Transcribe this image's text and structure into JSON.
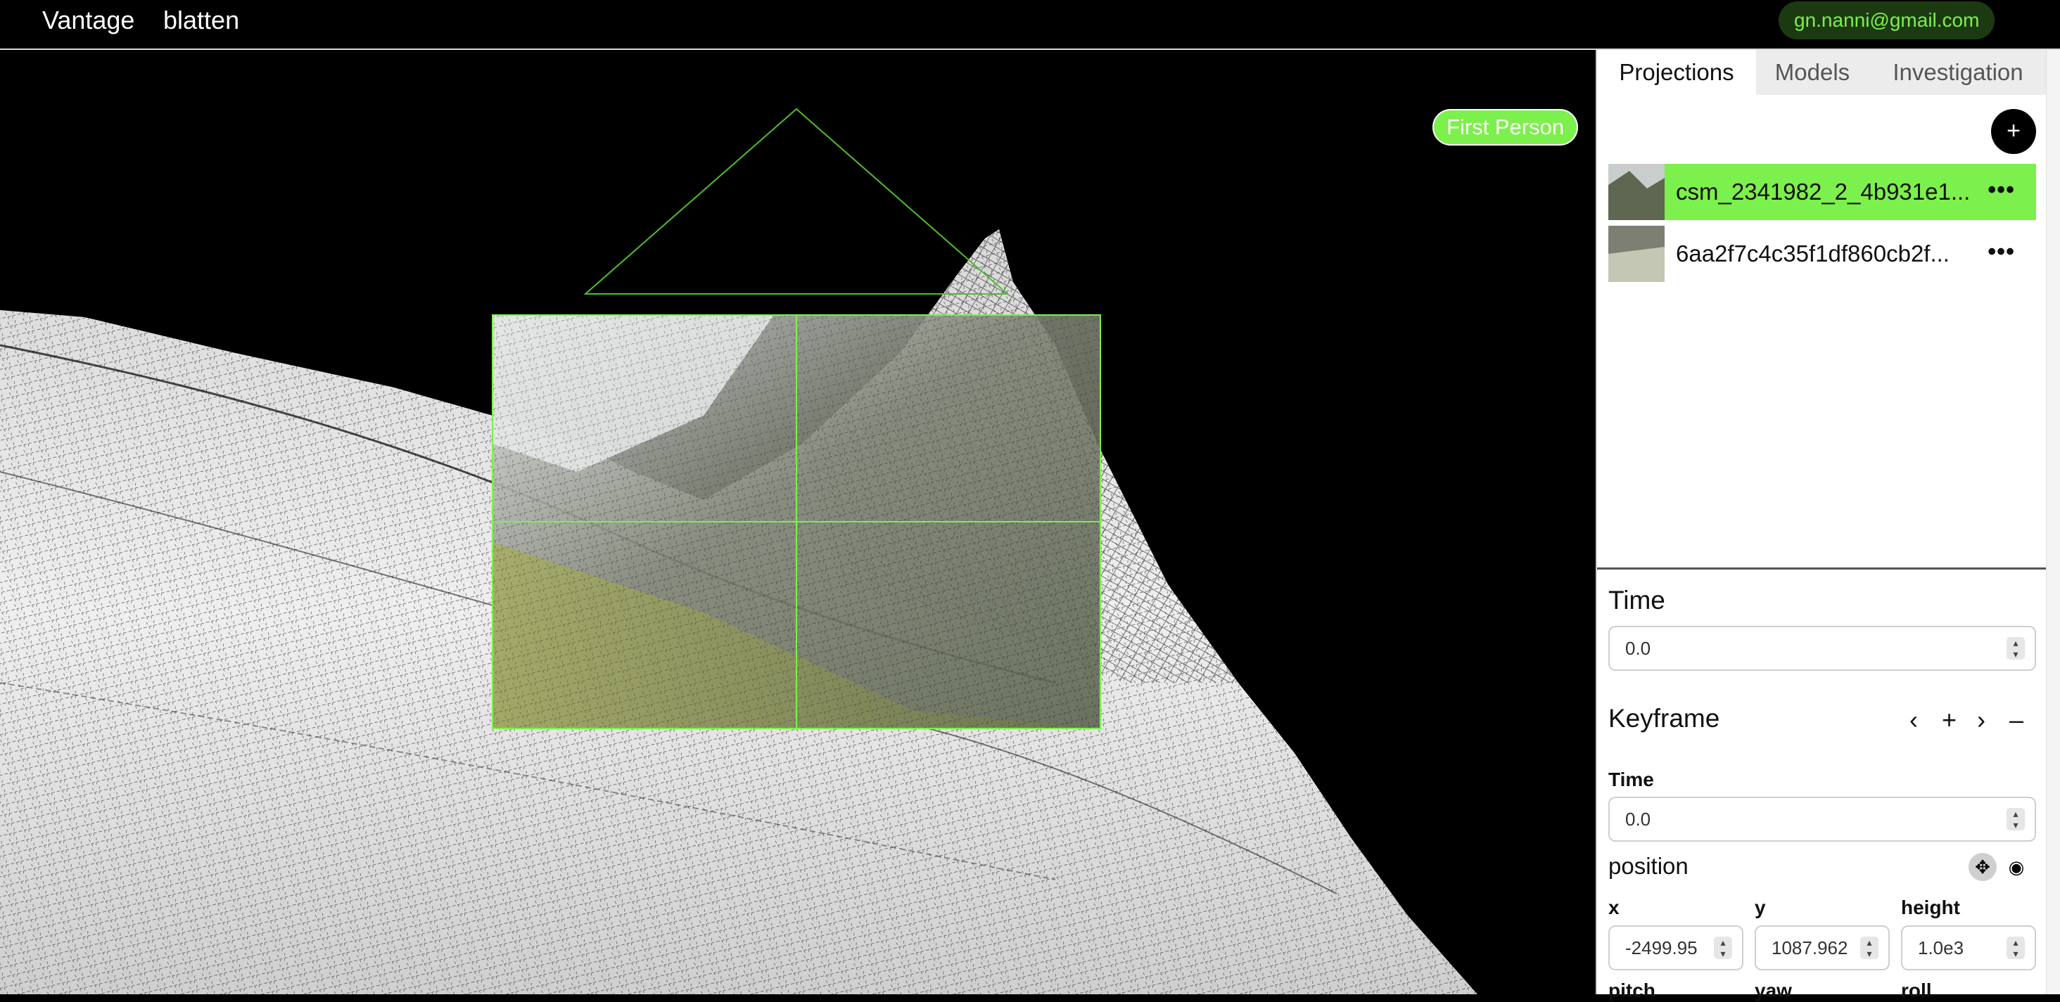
{
  "app": {
    "title": "Vantage",
    "project": "blatten",
    "user": "gn.nanni@gmail.com"
  },
  "viewport": {
    "mode_button": "First Person"
  },
  "sidebar": {
    "tabs": [
      {
        "label": "Projections"
      },
      {
        "label": "Models"
      },
      {
        "label": "Investigation"
      }
    ],
    "add_icon": "+",
    "projections": [
      {
        "name": "csm_2341982_2_4b931e1...",
        "more": "•••",
        "selected": true
      },
      {
        "name": "6aa2f7c4c35f1df860cb2f...",
        "more": "•••",
        "selected": false
      }
    ],
    "time": {
      "heading": "Time",
      "value": "0.0"
    },
    "keyframe": {
      "heading": "Keyframe",
      "prev": "‹",
      "add": "+",
      "next": "›",
      "remove": "–",
      "time_label": "Time",
      "time_value": "0.0",
      "position_heading": "position",
      "x_label": "x",
      "x_value": "-2499.95",
      "y_label": "y",
      "y_value": "1087.962",
      "height_label": "height",
      "height_value": "1.0e3",
      "pitch_label": "pitch",
      "yaw_label": "yaw",
      "roll_label": "roll"
    }
  },
  "colors": {
    "accent": "#7cf04c",
    "user_badge_bg": "#1c3a12",
    "panel_bg": "#ffffff",
    "viewport_bg": "#000000"
  }
}
